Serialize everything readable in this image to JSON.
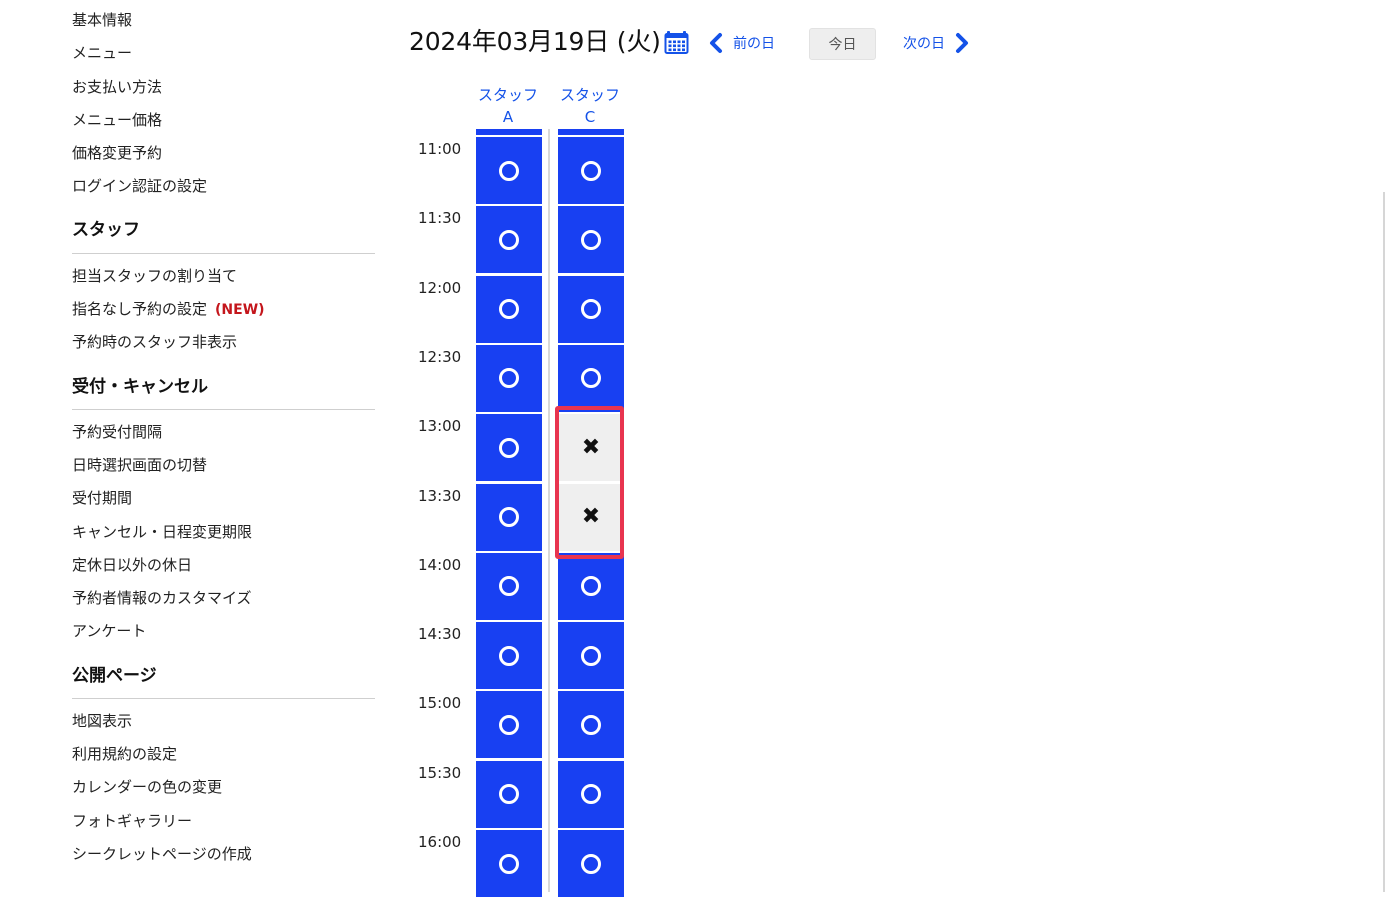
{
  "sidebar": {
    "top_items": [
      "基本情報",
      "メニュー",
      "お支払い方法",
      "メニュー価格",
      "価格変更予約",
      "ログイン認証の設定"
    ],
    "staff_section": {
      "title": "スタッフ",
      "items": [
        "担当スタッフの割り当て",
        "指名なし予約の設定",
        "予約時のスタッフ非表示"
      ],
      "new_badge": "(NEW)"
    },
    "reception_section": {
      "title": "受付・キャンセル",
      "items": [
        "予約受付間隔",
        "日時選択画面の切替",
        "受付期間",
        "キャンセル・日程変更期限",
        "定休日以外の休日",
        "予約者情報のカスタマイズ",
        "アンケート"
      ]
    },
    "public_section": {
      "title": "公開ページ",
      "items": [
        "地図表示",
        "利用規約の設定",
        "カレンダーの色の変更",
        "フォトギャラリー",
        "シークレットページの作成"
      ]
    }
  },
  "header": {
    "date": "2024年03月19日 (火)",
    "prev_day": "前の日",
    "today": "今日",
    "next_day": "次の日"
  },
  "schedule": {
    "staff": [
      {
        "line1": "スタッフ",
        "line2": "A"
      },
      {
        "line1": "スタッフ",
        "line2": "C"
      }
    ],
    "times": [
      "11:00",
      "11:30",
      "12:00",
      "12:30",
      "13:00",
      "13:30",
      "14:00",
      "14:30",
      "15:00",
      "15:30",
      "16:00"
    ],
    "availability": {
      "staff_a": [
        "○",
        "○",
        "○",
        "○",
        "○",
        "○",
        "○",
        "○",
        "○",
        "○",
        "○"
      ],
      "staff_c": [
        "○",
        "○",
        "○",
        "○",
        "×",
        "×",
        "○",
        "○",
        "○",
        "○",
        "○"
      ]
    }
  },
  "colors": {
    "available": "#1840f2",
    "unavailable": "#efefef",
    "link": "#1452e8",
    "new_badge": "#c4161c",
    "highlight": "#e8344f"
  }
}
